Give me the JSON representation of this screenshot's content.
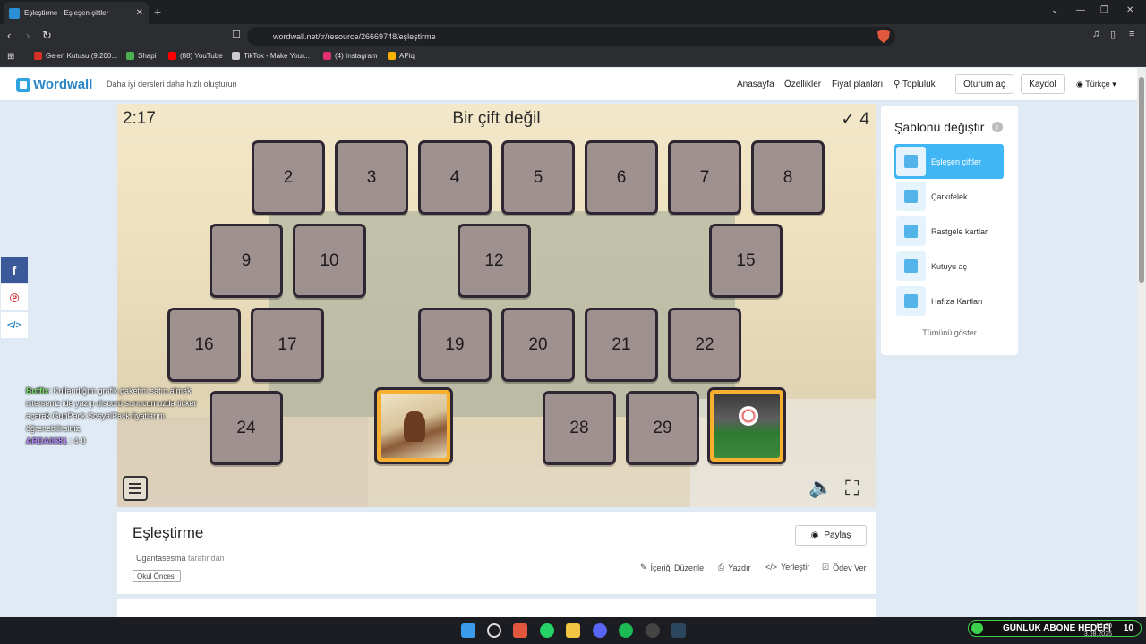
{
  "browser": {
    "tab_title": "Eşleştirme - Eşleşen çiftler",
    "tab_close": "✕",
    "new_tab": "+",
    "url": "wordwall.net/tr/resource/26669748/eşleştirme",
    "bookmarks": [
      {
        "label": "Gelen Kutusu (9.200...",
        "color": "#d93025"
      },
      {
        "label": "Shapi",
        "color": "#4caf50"
      },
      {
        "label": "(88) YouTube",
        "color": "#ff0000"
      },
      {
        "label": "TikTok - Make Your...",
        "color": "#cccccc"
      },
      {
        "label": "(4) Instagram",
        "color": "#e1306c"
      },
      {
        "label": "APiq",
        "color": "#ffb300"
      }
    ]
  },
  "header": {
    "logo": "Wordwall",
    "tagline": "Daha iyi dersleri daha hızlı oluşturun",
    "nav": [
      "Anasayfa",
      "Özellikler",
      "Fiyat planları",
      "Topluluk"
    ],
    "login": "Oturum aç",
    "signup": "Kaydol",
    "language": "Türkçe"
  },
  "game": {
    "timer": "2:17",
    "status": "Bir çift değil",
    "score_check": "✓",
    "score": "4",
    "cards": [
      "2",
      "3",
      "4",
      "5",
      "6",
      "7",
      "8",
      "9",
      "10",
      "12",
      "15",
      "16",
      "17",
      "19",
      "20",
      "21",
      "22",
      "24",
      "28",
      "29"
    ],
    "revealed": [
      "rider-image",
      "football-image"
    ]
  },
  "panel": {
    "title": "Şablonu değiştir",
    "templates": [
      "Eşleşen çiftler",
      "Çarkıfelek",
      "Rastgele kartlar",
      "Kutuyu aç",
      "Hafıza Kartları"
    ],
    "show_all": "Tümünü göster"
  },
  "activity": {
    "title": "Eşleştirme",
    "author": "Ugantasesma",
    "author_suffix": "tarafından",
    "tag": "Okul Öncesi",
    "share": "Paylaş",
    "actions": [
      "İçeriği Düzenle",
      "Yazdır",
      "Yerleştir",
      "Ödev Ver"
    ]
  },
  "chat": {
    "user1": "Buffix",
    "msg1": ": Kullandığım grafik paketini satın almak isterseniz ide yazıp discord sunucumuzda ticket açarak GunPack SosyalPack fiyatlarını öğrenebilirsiniz.",
    "user2": "ARDA0681",
    "msg2": ": 4-0"
  },
  "stream": {
    "sub_goal": "GÜNLÜK ABONE HEDEFİ",
    "sub_count": "10",
    "time": "01:30",
    "date": "3.08.2025"
  }
}
